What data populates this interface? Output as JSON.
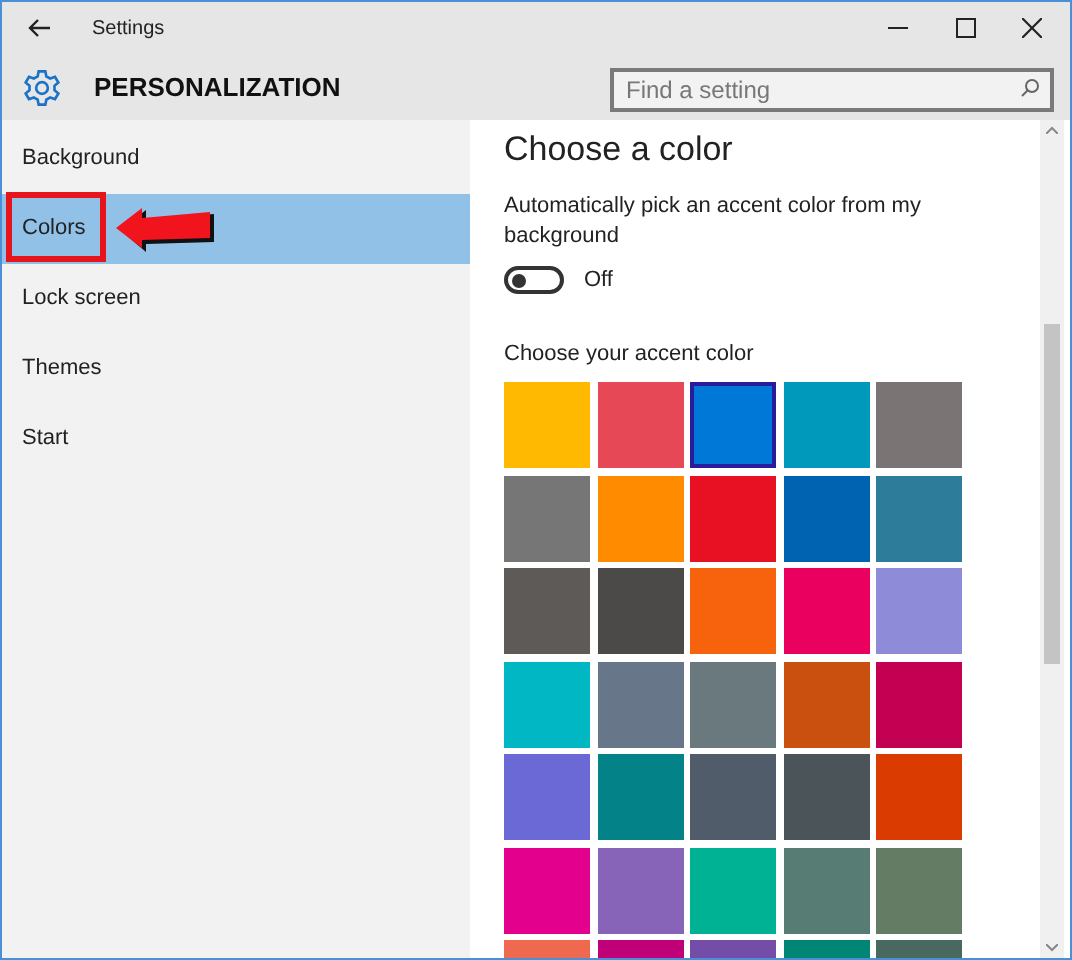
{
  "window": {
    "title": "Settings"
  },
  "header": {
    "title": "PERSONALIZATION"
  },
  "search": {
    "placeholder": "Find a setting"
  },
  "sidebar": {
    "items": [
      {
        "label": "Background",
        "selected": false
      },
      {
        "label": "Colors",
        "selected": true
      },
      {
        "label": "Lock screen",
        "selected": false
      },
      {
        "label": "Themes",
        "selected": false
      },
      {
        "label": "Start",
        "selected": false
      }
    ]
  },
  "content": {
    "heading": "Choose a color",
    "auto_pick": {
      "label": "Automatically pick an accent color from my background",
      "on": false,
      "state_text": "Off"
    },
    "accent_label": "Choose your accent color",
    "swatches": [
      {
        "color": "#ffb900",
        "selected": false
      },
      {
        "color": "#e74856",
        "selected": false
      },
      {
        "color": "#0078d7",
        "selected": true
      },
      {
        "color": "#0099bc",
        "selected": false
      },
      {
        "color": "#7a7574",
        "selected": false
      },
      {
        "color": "#767676",
        "selected": false
      },
      {
        "color": "#ff8c00",
        "selected": false
      },
      {
        "color": "#e81123",
        "selected": false
      },
      {
        "color": "#0063b1",
        "selected": false
      },
      {
        "color": "#2d7d9a",
        "selected": false
      },
      {
        "color": "#5d5a58",
        "selected": false
      },
      {
        "color": "#4c4a48",
        "selected": false
      },
      {
        "color": "#f7630c",
        "selected": false
      },
      {
        "color": "#ea005e",
        "selected": false
      },
      {
        "color": "#8e8cd8",
        "selected": false
      },
      {
        "color": "#00b7c3",
        "selected": false
      },
      {
        "color": "#68768a",
        "selected": false
      },
      {
        "color": "#69797e",
        "selected": false
      },
      {
        "color": "#ca5010",
        "selected": false
      },
      {
        "color": "#c30052",
        "selected": false
      },
      {
        "color": "#6b69d6",
        "selected": false
      },
      {
        "color": "#038387",
        "selected": false
      },
      {
        "color": "#515c6b",
        "selected": false
      },
      {
        "color": "#4a5459",
        "selected": false
      },
      {
        "color": "#da3b01",
        "selected": false
      },
      {
        "color": "#e3008c",
        "selected": false
      },
      {
        "color": "#8764b8",
        "selected": false
      },
      {
        "color": "#00b294",
        "selected": false
      },
      {
        "color": "#567c73",
        "selected": false
      },
      {
        "color": "#647c64",
        "selected": false
      },
      {
        "color": "#ef6950",
        "selected": false
      },
      {
        "color": "#bf0077",
        "selected": false
      },
      {
        "color": "#744da9",
        "selected": false
      },
      {
        "color": "#018574",
        "selected": false
      },
      {
        "color": "#486860",
        "selected": false
      }
    ]
  }
}
